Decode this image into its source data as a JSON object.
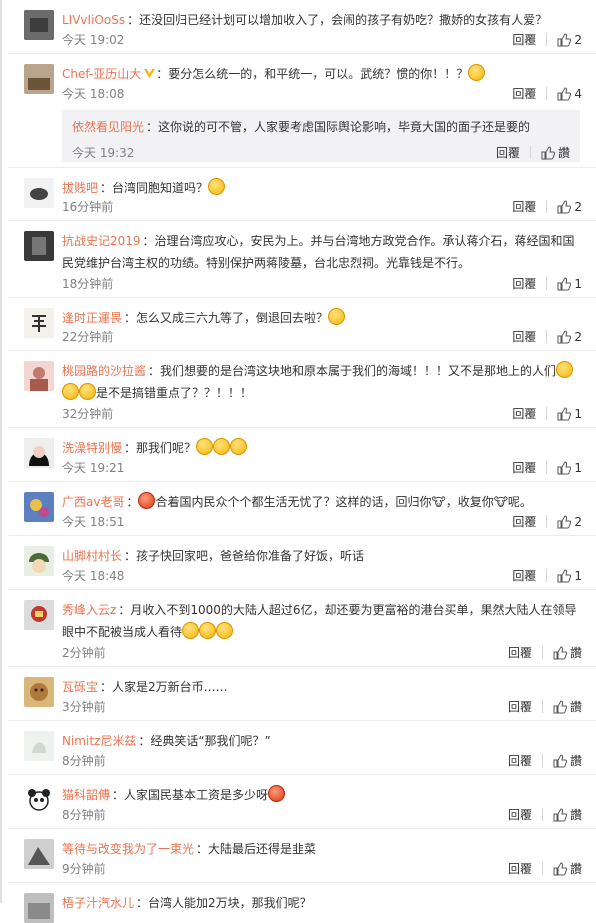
{
  "ui": {
    "reply_label": "回覆",
    "praise_label": "讚"
  },
  "comments": [
    {
      "user": "LIVvIiOoSs",
      "text": "还没回归已经计划可以增加收入了，会闹的孩子有奶吃？撒娇的女孩有人爱？",
      "emojis": [],
      "time": "今天 19:02",
      "likes": "2"
    },
    {
      "user": "Chef-亚历山大",
      "text": "：要分怎么统一的，和平统一，可以。武统？惯的你！！？",
      "emojis": [
        "yellow"
      ],
      "time": "今天 18:08",
      "likes": "4",
      "verified": true,
      "reply": {
        "user": "依然看见阳光",
        "text": "：这你说的可不管，人家要考虑国际舆论影响，毕竟大国的面子还是要的",
        "time": "今天 19:32",
        "likes": "讚"
      }
    },
    {
      "user": "拔贱吧",
      "text": "：台湾同胞知道吗？",
      "emojis": [
        "yellow"
      ],
      "time": "16分钟前",
      "likes": "2"
    },
    {
      "user": "抗战史记2019",
      "text": "：治理台湾应攻心，安民为上。并与台湾地方政党合作。承认蒋介石，蒋经国和国民党维护台湾主权的功绩。特别保护两蒋陵墓，台北忠烈祠。光靠钱是不行。",
      "emojis": [],
      "time": "18分钟前",
      "likes": "1"
    },
    {
      "user": "逢时正運畏",
      "text": "：怎么又成三六九等了，倒退回去啦？",
      "emojis": [
        "cry"
      ],
      "time": "22分钟前",
      "likes": "2"
    },
    {
      "user": "桃园路的沙拉酱",
      "text": "：我们想要的是台湾这块地和原本属于我们的海域！！！又不是那地上的人们",
      "text2": "是不是搞错重点了？？！！！",
      "emojis": [
        "yellow"
      ],
      "emojis2": [
        "yellow",
        "yellow"
      ],
      "time": "32分钟前",
      "likes": "1"
    },
    {
      "user": "洗澡特别慢",
      "text": "：那我们呢？",
      "emojis": [
        "yellow",
        "yellow",
        "yellow"
      ],
      "time": "今天 19:21",
      "likes": "1"
    },
    {
      "user": "广西av老哥",
      "text": "合着国内民众个个都生活无忧了？这样的话，回归你",
      "text_mid": "，收复你",
      "text_end": "呢。",
      "emojis_pre": [
        "red"
      ],
      "time": "今天 18:51",
      "likes": "2"
    },
    {
      "user": "山脚村村长",
      "text": "：孩子快回家吧，爸爸给你准备了好饭，听话",
      "emojis": [],
      "time": "今天 18:48",
      "likes": "1"
    },
    {
      "user": "秀峰入云z",
      "text": "：月收入不到1000的大陆人超过6亿，却还要为更富裕的港台买单，果然大陆人在领导眼中不配被当成人看待",
      "emojis": [
        "cry",
        "cry",
        "cry"
      ],
      "time": "2分钟前",
      "likes": "讚"
    },
    {
      "user": "瓦砾宝",
      "text": "：人家是2万新台币……",
      "emojis": [],
      "time": "3分钟前",
      "likes": "讚"
    },
    {
      "user": "Nimitz尼米兹",
      "text": "：经典笑话“那我们呢？”",
      "emojis": [],
      "time": "8分钟前",
      "likes": "讚"
    },
    {
      "user": "猫科韶傅",
      "text": "：人家国民基本工资是多少呀",
      "emojis": [
        "red"
      ],
      "time": "8分钟前",
      "likes": "讚"
    },
    {
      "user": "等待与改变我为了一束光",
      "text": "：大陆最后还得是韭菜",
      "emojis": [],
      "time": "9分钟前",
      "likes": "讚"
    },
    {
      "user": "梧子汁汽水儿",
      "text": "：台湾人能加2万块，那我们呢？",
      "emojis": [],
      "time": "",
      "likes": ""
    }
  ],
  "colors": {
    "username": "#eb7350",
    "text": "#333333",
    "meta": "#808080",
    "reply_bg": "#f2f2f5"
  }
}
